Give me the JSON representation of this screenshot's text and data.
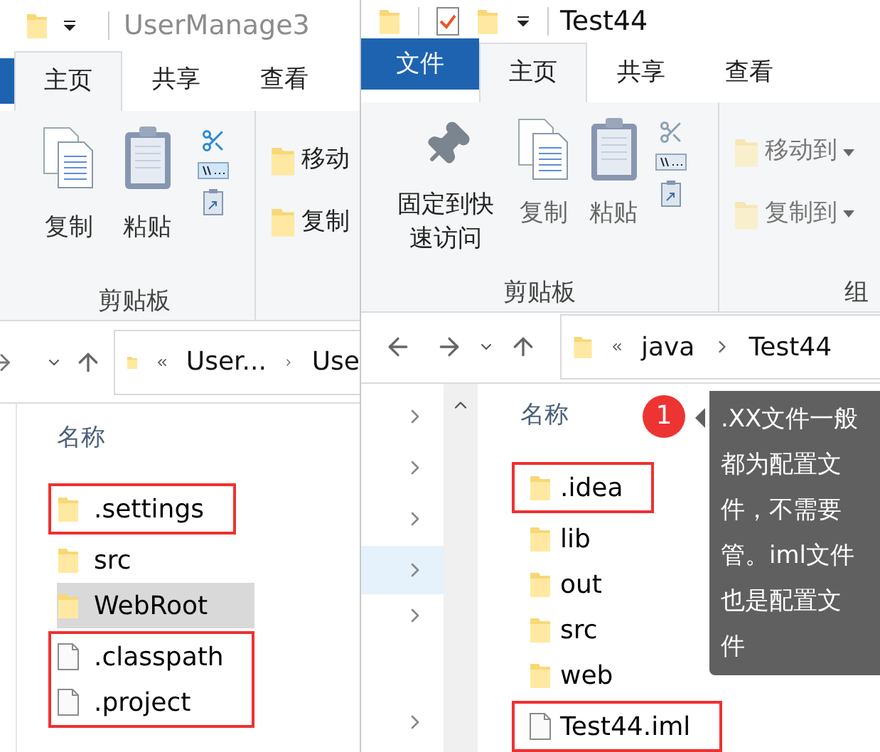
{
  "back_window": {
    "title": "UserManage3",
    "tabs": [
      {
        "label": "主页",
        "selected": true
      },
      {
        "label": "共享",
        "selected": false
      },
      {
        "label": "查看",
        "selected": false
      }
    ],
    "clipboard": {
      "buttons": [
        {
          "label": "复制",
          "kind": "copy"
        },
        {
          "label": "粘贴",
          "kind": "paste"
        }
      ],
      "group_label": "剪贴板"
    },
    "organize": {
      "buttons": [
        "移动",
        "复制"
      ]
    },
    "address": {
      "path": [
        "User...",
        "Use"
      ]
    },
    "column_header": "名称",
    "file_groups": [
      {
        "boxed": true,
        "items": [
          {
            "name": ".settings",
            "kind": "folder",
            "selected": false
          }
        ]
      },
      {
        "boxed": false,
        "items": [
          {
            "name": "src",
            "kind": "folder",
            "selected": false
          },
          {
            "name": "WebRoot",
            "kind": "folder",
            "selected": true
          }
        ]
      },
      {
        "boxed": true,
        "items": [
          {
            "name": ".classpath",
            "kind": "file",
            "selected": false
          },
          {
            "name": ".project",
            "kind": "file",
            "selected": false
          }
        ]
      }
    ]
  },
  "front_window": {
    "title": "Test44",
    "file_tab": "文件",
    "tabs": [
      {
        "label": "主页",
        "selected": true
      },
      {
        "label": "共享",
        "selected": false
      },
      {
        "label": "查看",
        "selected": false
      }
    ],
    "clipboard": {
      "buttons": [
        {
          "label": "固定到快速访问",
          "kind": "pin"
        },
        {
          "label": "复制",
          "kind": "copy"
        },
        {
          "label": "粘贴",
          "kind": "paste"
        }
      ],
      "group_label": "剪贴板"
    },
    "organize": {
      "buttons": [
        "移动到",
        "复制到"
      ],
      "group_label": "组"
    },
    "address": {
      "path": [
        "java",
        "Test44"
      ]
    },
    "nav_items": [
      {
        "selected": false
      },
      {
        "selected": false
      },
      {
        "selected": false
      },
      {
        "selected": true
      },
      {
        "selected": false
      },
      {
        "selected": false
      }
    ],
    "column_header": "名称",
    "file_groups": [
      {
        "boxed": true,
        "items": [
          {
            "name": ".idea",
            "kind": "folder",
            "selected": false
          }
        ]
      },
      {
        "boxed": false,
        "items": [
          {
            "name": "lib",
            "kind": "folder",
            "selected": false
          },
          {
            "name": "out",
            "kind": "folder",
            "selected": false
          },
          {
            "name": "src",
            "kind": "folder",
            "selected": false
          },
          {
            "name": "web",
            "kind": "folder",
            "selected": false
          }
        ]
      },
      {
        "boxed": true,
        "items": [
          {
            "name": "Test44.iml",
            "kind": "file",
            "selected": false
          }
        ]
      }
    ],
    "callout": {
      "badge": "1",
      "text": ".XX文件一般都为配置文件，不需要管。iml文件也是配置文件"
    }
  }
}
